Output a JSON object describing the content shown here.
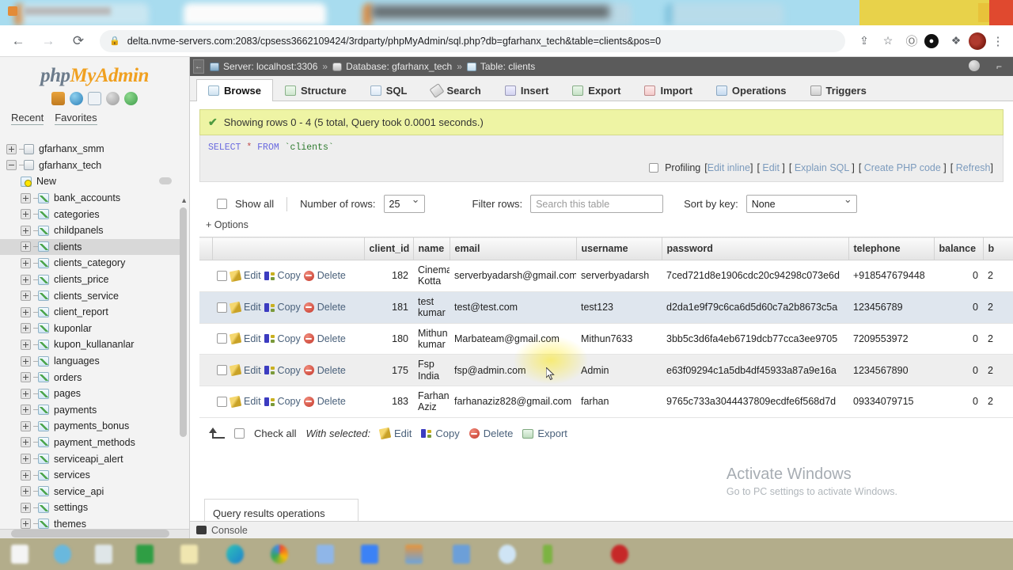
{
  "browser": {
    "url": "delta.nvme-servers.com:2083/cpsess3662109424/3rdparty/phpMyAdmin/sql.php?db=gfarhanx_tech&table=clients&pos=0",
    "back_icon": "←",
    "forward_icon": "→",
    "reload_icon": "⟳",
    "lock_icon": "🔒",
    "share_icon": "⇪",
    "bookmark_icon": "☆",
    "wordpress_icon": "W",
    "whatsapp_icon": "◍",
    "extensions_icon": "✦",
    "profile_icon": "avatar",
    "menu_icon": "⋮"
  },
  "sidebar": {
    "logo_php": "php",
    "logo_myadmin": "MyAdmin",
    "nav_icons": [
      "home-icon",
      "globe-icon",
      "docs-icon",
      "settings-icon",
      "help-icon"
    ],
    "recent": "Recent",
    "favorites": "Favorites",
    "databases": [
      {
        "label": "gfarhanx_smm",
        "type": "db",
        "expanded": false,
        "selected": false
      },
      {
        "label": "gfarhanx_tech",
        "type": "db",
        "expanded": true,
        "selected": false
      }
    ],
    "tables": [
      {
        "label": "New",
        "type": "new",
        "selected": false
      },
      {
        "label": "bank_accounts",
        "type": "table",
        "selected": false
      },
      {
        "label": "categories",
        "type": "table",
        "selected": false
      },
      {
        "label": "childpanels",
        "type": "table",
        "selected": false
      },
      {
        "label": "clients",
        "type": "table",
        "selected": true
      },
      {
        "label": "clients_category",
        "type": "table",
        "selected": false
      },
      {
        "label": "clients_price",
        "type": "table",
        "selected": false
      },
      {
        "label": "clients_service",
        "type": "table",
        "selected": false
      },
      {
        "label": "client_report",
        "type": "table",
        "selected": false
      },
      {
        "label": "kuponlar",
        "type": "table",
        "selected": false
      },
      {
        "label": "kupon_kullananlar",
        "type": "table",
        "selected": false
      },
      {
        "label": "languages",
        "type": "table",
        "selected": false
      },
      {
        "label": "orders",
        "type": "table",
        "selected": false
      },
      {
        "label": "pages",
        "type": "table",
        "selected": false
      },
      {
        "label": "payments",
        "type": "table",
        "selected": false
      },
      {
        "label": "payments_bonus",
        "type": "table",
        "selected": false
      },
      {
        "label": "payment_methods",
        "type": "table",
        "selected": false
      },
      {
        "label": "serviceapi_alert",
        "type": "table",
        "selected": false
      },
      {
        "label": "services",
        "type": "table",
        "selected": false
      },
      {
        "label": "service_api",
        "type": "table",
        "selected": false
      },
      {
        "label": "settings",
        "type": "table",
        "selected": false
      },
      {
        "label": "themes",
        "type": "table",
        "selected": false
      }
    ]
  },
  "breadcrumb": {
    "server_label": "Server: localhost:3306",
    "database_label": "Database: gfarhanx_tech",
    "table_label": "Table: clients",
    "separator": "»"
  },
  "tabs": [
    {
      "label": "Browse",
      "icon": "browse-icon",
      "active": true
    },
    {
      "label": "Structure",
      "icon": "structure-icon",
      "active": false
    },
    {
      "label": "SQL",
      "icon": "sql-icon",
      "active": false
    },
    {
      "label": "Search",
      "icon": "search-icon",
      "active": false
    },
    {
      "label": "Insert",
      "icon": "insert-icon",
      "active": false
    },
    {
      "label": "Export",
      "icon": "export-icon",
      "active": false
    },
    {
      "label": "Import",
      "icon": "import-icon",
      "active": false
    },
    {
      "label": "Operations",
      "icon": "operations-icon",
      "active": false
    },
    {
      "label": "Triggers",
      "icon": "triggers-icon",
      "active": false
    }
  ],
  "result": {
    "message": "Showing rows 0 - 4 (5 total, Query took 0.0001 seconds.)",
    "check_icon": "✔",
    "sql_keyword1": "SELECT",
    "sql_star": "*",
    "sql_keyword2": "FROM",
    "sql_table": "`clients`"
  },
  "profiling": {
    "label": "Profiling",
    "links": [
      "Edit inline",
      "Edit",
      "Explain SQL",
      "Create PHP code",
      "Refresh"
    ]
  },
  "options": {
    "show_all": "Show all",
    "number_of_rows_label": "Number of rows:",
    "number_of_rows_value": "25",
    "filter_rows_label": "Filter rows:",
    "filter_placeholder": "Search this table",
    "sort_by_key_label": "Sort by key:",
    "sort_by_key_value": "None",
    "options_toggle": "+ Options"
  },
  "table": {
    "action_labels": {
      "edit": "Edit",
      "copy": "Copy",
      "delete": "Delete"
    },
    "columns": [
      "client_id",
      "name",
      "email",
      "username",
      "password",
      "telephone",
      "balance",
      "b"
    ],
    "rows": [
      {
        "client_id": "182",
        "name": "Cinema Kotta",
        "email": "serverbyadarsh@gmail.com",
        "username": "serverbyadarsh",
        "password": "7ced721d8e1906cdc20c94298c073e6d",
        "telephone": "+918547679448",
        "balance": "0",
        "extra": "2"
      },
      {
        "client_id": "181",
        "name": "test kumar",
        "email": "test@test.com",
        "username": "test123",
        "password": "d2da1e9f79c6ca6d5d60c7a2b8673c5a",
        "telephone": "123456789",
        "balance": "0",
        "extra": "2"
      },
      {
        "client_id": "180",
        "name": "Mithun kumar",
        "email": "Marbateam@gmail.com",
        "username": "Mithun7633",
        "password": "3bb5c3d6fa4eb6719dcb77cca3ee9705",
        "telephone": "7209553972",
        "balance": "0",
        "extra": "2"
      },
      {
        "client_id": "175",
        "name": "Fsp India",
        "email": "fsp@admin.com",
        "username": "Admin",
        "password": "e63f09294c1a5db4df45933a87a9e16a",
        "telephone": "1234567890",
        "balance": "0",
        "extra": "2"
      },
      {
        "client_id": "183",
        "name": "Farhan Aziz",
        "email": "farhanaziz828@gmail.com",
        "username": "farhan",
        "password": "9765c733a3044437809ecdfe6f568d7d",
        "telephone": "09334079715",
        "balance": "0",
        "extra": "2"
      }
    ]
  },
  "bottom_actions": {
    "check_all": "Check all",
    "with_selected": "With selected:",
    "edit": "Edit",
    "copy": "Copy",
    "delete": "Delete",
    "export": "Export"
  },
  "query_results_operations": "Query results operations",
  "console": {
    "label": "Console",
    "icon": "console-icon"
  },
  "watermark": {
    "title": "Activate Windows",
    "subtitle": "Go to PC settings to activate Windows."
  }
}
